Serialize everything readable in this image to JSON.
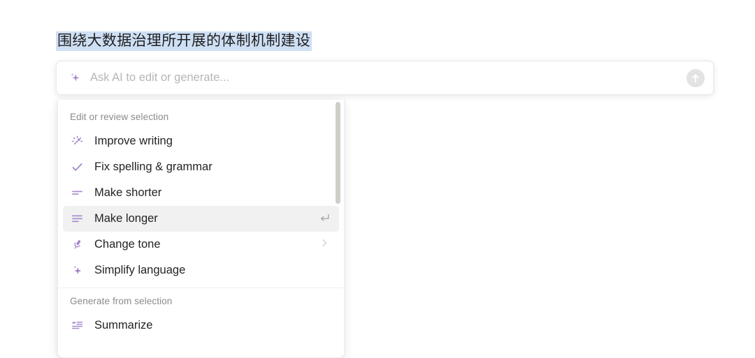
{
  "document": {
    "selected_text": "围绕大数据治理所开展的体制机制建设"
  },
  "ai_bar": {
    "placeholder": "Ask AI to edit or generate...",
    "value": "",
    "spark_icon": "sparkle-icon",
    "submit_icon": "arrow-up-circle-icon"
  },
  "menu": {
    "sections": [
      {
        "label": "Edit or review selection",
        "items": [
          {
            "label": "Improve writing",
            "icon": "magic-wand-sparkle-icon",
            "hint": "",
            "submenu": false,
            "active": false
          },
          {
            "label": "Fix spelling & grammar",
            "icon": "check-icon",
            "hint": "",
            "submenu": false,
            "active": false
          },
          {
            "label": "Make shorter",
            "icon": "two-lines-icon",
            "hint": "",
            "submenu": false,
            "active": false
          },
          {
            "label": "Make longer",
            "icon": "three-lines-icon",
            "hint": "↵",
            "submenu": false,
            "active": true
          },
          {
            "label": "Change tone",
            "icon": "microphone-icon",
            "hint": "",
            "submenu": true,
            "active": false
          },
          {
            "label": "Simplify language",
            "icon": "sparkle-icon",
            "hint": "",
            "submenu": false,
            "active": false
          }
        ]
      },
      {
        "label": "Generate from selection",
        "items": [
          {
            "label": "Summarize",
            "icon": "quote-lines-icon",
            "hint": "",
            "submenu": false,
            "active": false
          }
        ]
      }
    ],
    "scrollbar": {
      "visible": true
    }
  },
  "colors": {
    "accent_purple": "#9b7cc4",
    "selection_blue": "#cfe0f5",
    "active_row": "#f2f1f1",
    "text_primary": "#232323",
    "text_muted": "#8d8a8d"
  }
}
